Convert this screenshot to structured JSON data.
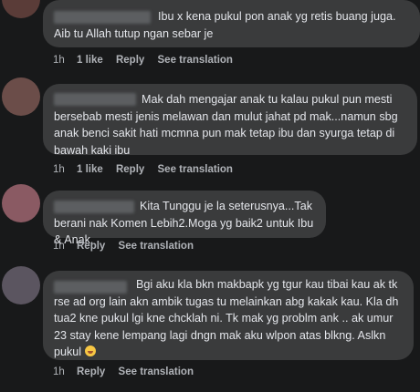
{
  "comments": [
    {
      "text": "Ibu x kena pukul pon anak yg retis buang juga. Aib tu Allah tutup ngan sebar je",
      "time": "1h",
      "like": "1 like",
      "reply": "Reply",
      "translate": "See translation",
      "avatar_color": "#5a3c38"
    },
    {
      "text": "Mak dah mengajar anak tu kalau pukul pun mesti bersebab mesti jenis melawan dan mulut jahat pd mak...namun sbg anak benci sakit hati mcmna pun mak tetap ibu dan syurga tetap di bawah kaki ibu",
      "time": "1h",
      "like": "1 like",
      "reply": "Reply",
      "translate": "See translation",
      "avatar_color": "#6b4d49"
    },
    {
      "text": "Kita Tunggu je la seterusnya...Tak berani nak Komen Lebih2.Moga yg baik2 untuk Ibu & Anak.",
      "time": "1h",
      "reply": "Reply",
      "translate": "See translation",
      "avatar_color": "#8a5a63"
    },
    {
      "text": "Bgi aku kla bkn makbapk yg tgur kau tibai kau ak tk rse ad org lain akn ambik tugas tu melainkan abg kakak kau. Kla dh tua2 kne pukul lgi kne chcklah ni. Tk mak yg problm ank .. ak umur 23 stay kene lempang lagi dngn mak aku wlpon atas blkng. Aslkn pukul",
      "emoji": "laughing-emoji",
      "time": "1h",
      "reply": "Reply",
      "translate": "See translation",
      "avatar_color": "#5b5560"
    }
  ]
}
